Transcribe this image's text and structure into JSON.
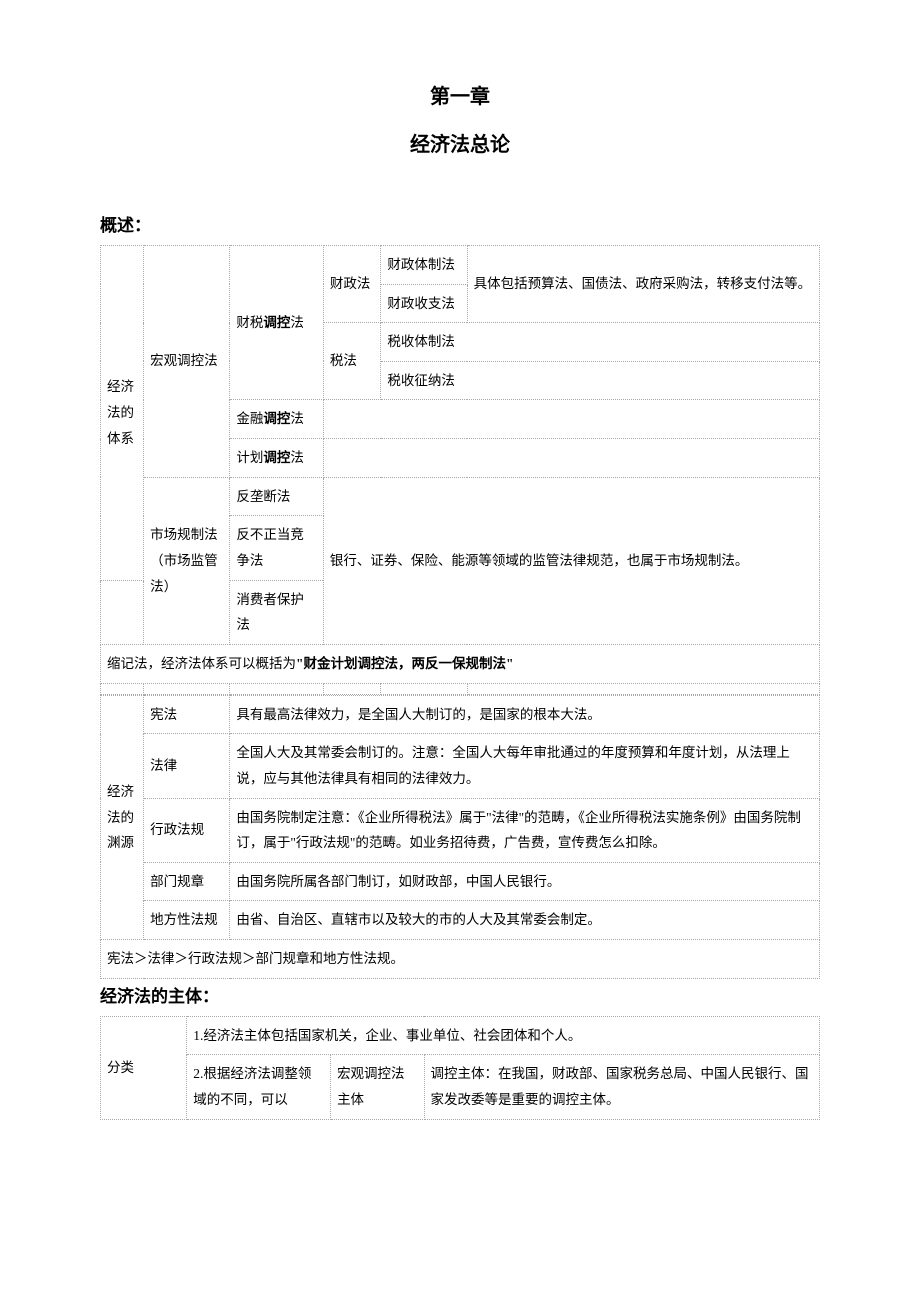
{
  "chapter_title": "第一章",
  "chapter_subtitle": "经济法总论",
  "section1_header": "概述：",
  "overview": {
    "root": "经济法的体系",
    "macro": "宏观调控法",
    "tax_control": "财税调控法",
    "fiscal_law": "财政法",
    "fiscal_system_law": "财政体制法",
    "fiscal_revexp_law": "财政收支法",
    "fiscal_desc": "具体包括预算法、国债法、政府采购法，转移支付法等。",
    "tax_law": "税法",
    "tax_system_law": "税收体制法",
    "tax_collect_law": "税收征纳法",
    "fin_control": "金融调控法",
    "plan_control": "计划调控法",
    "market_reg": "市场规制法（市场监管法）",
    "anti_monopoly": "反垄断法",
    "anti_unfair": "反不正当竞争法",
    "consumer": "消费者保护法",
    "market_desc": "银行、证券、保险、能源等领域的监管法律规范，也属于市场规制法。",
    "mnemonic_prefix": "缩记法，经济法体系可以概括为",
    "mnemonic_quote": "\"财金计划调控法，两反一保规制法\""
  },
  "sources": {
    "root": "经济法的渊源",
    "items": [
      {
        "name": "宪法",
        "desc": "具有最高法律效力，是全国人大制订的，是国家的根本大法。"
      },
      {
        "name": "法律",
        "desc": "全国人大及其常委会制订的。注意：全国人大每年审批通过的年度预算和年度计划，从法理上说，应与其他法律具有相同的法律效力。"
      },
      {
        "name": "行政法规",
        "desc": "由国务院制定注意：《企业所得税法》属于\"法律\"的范畴，《企业所得税法实施条例》由国务院制订，属于\"行政法规\"的范畴。如业务招待费，广告费，宣传费怎么扣除。"
      },
      {
        "name": "部门规章",
        "desc": "由国务院所属各部门制订，如财政部，中国人民银行。"
      },
      {
        "name": "地方性法规",
        "desc": "由省、自治区、直辖市以及较大的市的人大及其常委会制定。"
      }
    ],
    "hierarchy": "宪法＞法律＞行政法规＞部门规章和地方性法规。"
  },
  "section3_header": "经济法的主体：",
  "subject": {
    "category": "分类",
    "row1": "1.经济法主体包括国家机关，企业、事业单位、社会团体和个人。",
    "row2_left": "2.根据经济法调整领域的不同，可以",
    "row2_mid": "宏观调控法主体",
    "row2_right": "调控主体：在我国，财政部、国家税务总局、中国人民银行、国家发改委等是重要的调控主体。"
  }
}
